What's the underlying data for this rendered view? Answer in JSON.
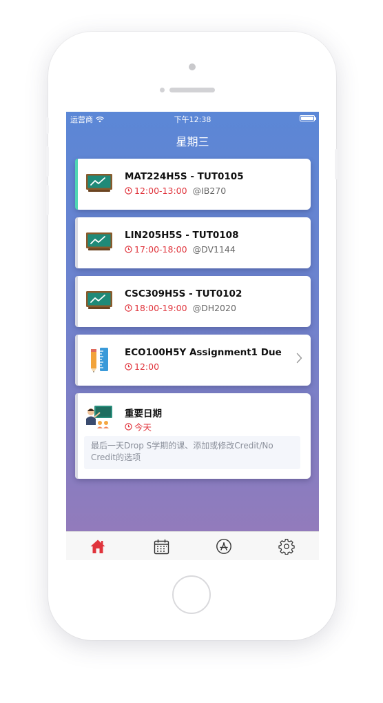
{
  "status_bar": {
    "carrier": "运营商",
    "time": "下午12:38"
  },
  "nav": {
    "title": "星期三"
  },
  "cards": [
    {
      "title": "MAT224H5S - TUT0105",
      "time": "12:00-13:00",
      "location": "@IB270"
    },
    {
      "title": "LIN205H5S - TUT0108",
      "time": "17:00-18:00",
      "location": "@DV1144"
    },
    {
      "title": "CSC309H5S - TUT0102",
      "time": "18:00-19:00",
      "location": "@DH2020"
    },
    {
      "title": "ECO100H5Y Assignment1 Due",
      "time": "12:00"
    },
    {
      "title": "重要日期",
      "time": "今天",
      "note": "最后一天Drop S学期的课、添加或修改Credit/No Credit的选项"
    }
  ],
  "tabs": [
    "home-icon",
    "calendar-icon",
    "app-store-icon",
    "settings-gear-icon"
  ],
  "colors": {
    "accent": "#e0343c",
    "active_bar": "#4fd6b4",
    "active_tab": "#e0343c"
  }
}
